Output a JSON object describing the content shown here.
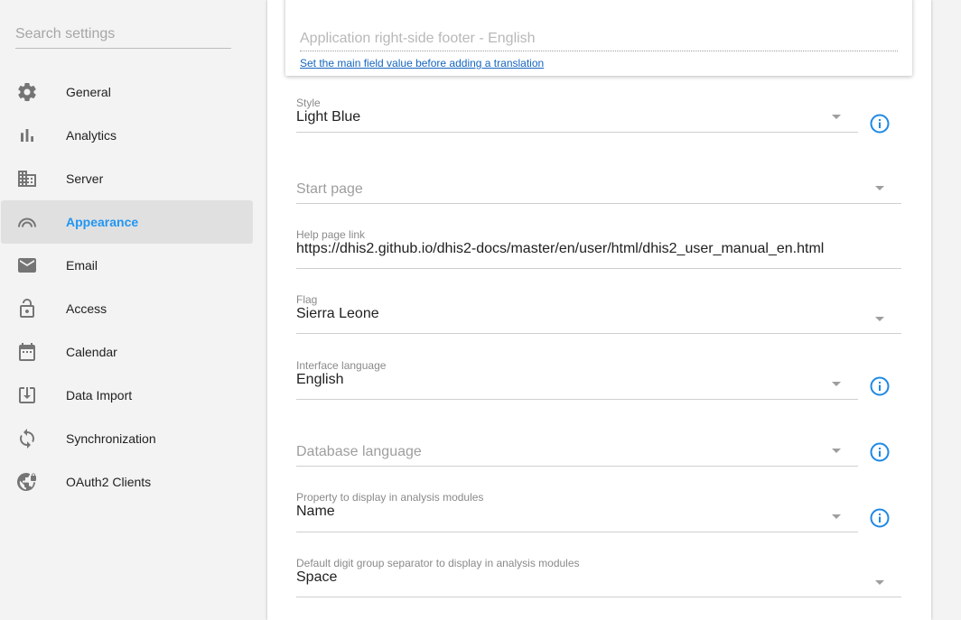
{
  "sidebar": {
    "search_placeholder": "Search settings",
    "items": [
      {
        "label": "General",
        "icon": "gear-icon"
      },
      {
        "label": "Analytics",
        "icon": "bar-chart-icon"
      },
      {
        "label": "Server",
        "icon": "building-icon"
      },
      {
        "label": "Appearance",
        "icon": "arc-icon",
        "active": true
      },
      {
        "label": "Email",
        "icon": "mail-icon"
      },
      {
        "label": "Access",
        "icon": "lock-icon"
      },
      {
        "label": "Calendar",
        "icon": "calendar-icon"
      },
      {
        "label": "Data Import",
        "icon": "download-icon"
      },
      {
        "label": "Synchronization",
        "icon": "sync-icon"
      },
      {
        "label": "OAuth2 Clients",
        "icon": "globe-lock-icon"
      }
    ],
    "active_color": "#2196f3"
  },
  "footer_translation": {
    "placeholder": "Application right-side footer - English",
    "link": "Set the main field value before adding a translation"
  },
  "fields": {
    "style": {
      "label": "Style",
      "value": "Light Blue"
    },
    "start_page": {
      "placeholder": "Start page"
    },
    "help_page_link": {
      "label": "Help page link",
      "value": "https://dhis2.github.io/dhis2-docs/master/en/user/html/dhis2_user_manual_en.html"
    },
    "flag": {
      "label": "Flag",
      "value": "Sierra Leone"
    },
    "interface_language": {
      "label": "Interface language",
      "value": "English"
    },
    "database_language": {
      "placeholder": "Database language"
    },
    "analysis_property": {
      "label": "Property to display in analysis modules",
      "value": "Name"
    },
    "digit_separator": {
      "label": "Default digit group separator to display in analysis modules",
      "value": "Space"
    }
  },
  "colors": {
    "info_icon": "#1e88e5",
    "link": "#1565c0"
  }
}
